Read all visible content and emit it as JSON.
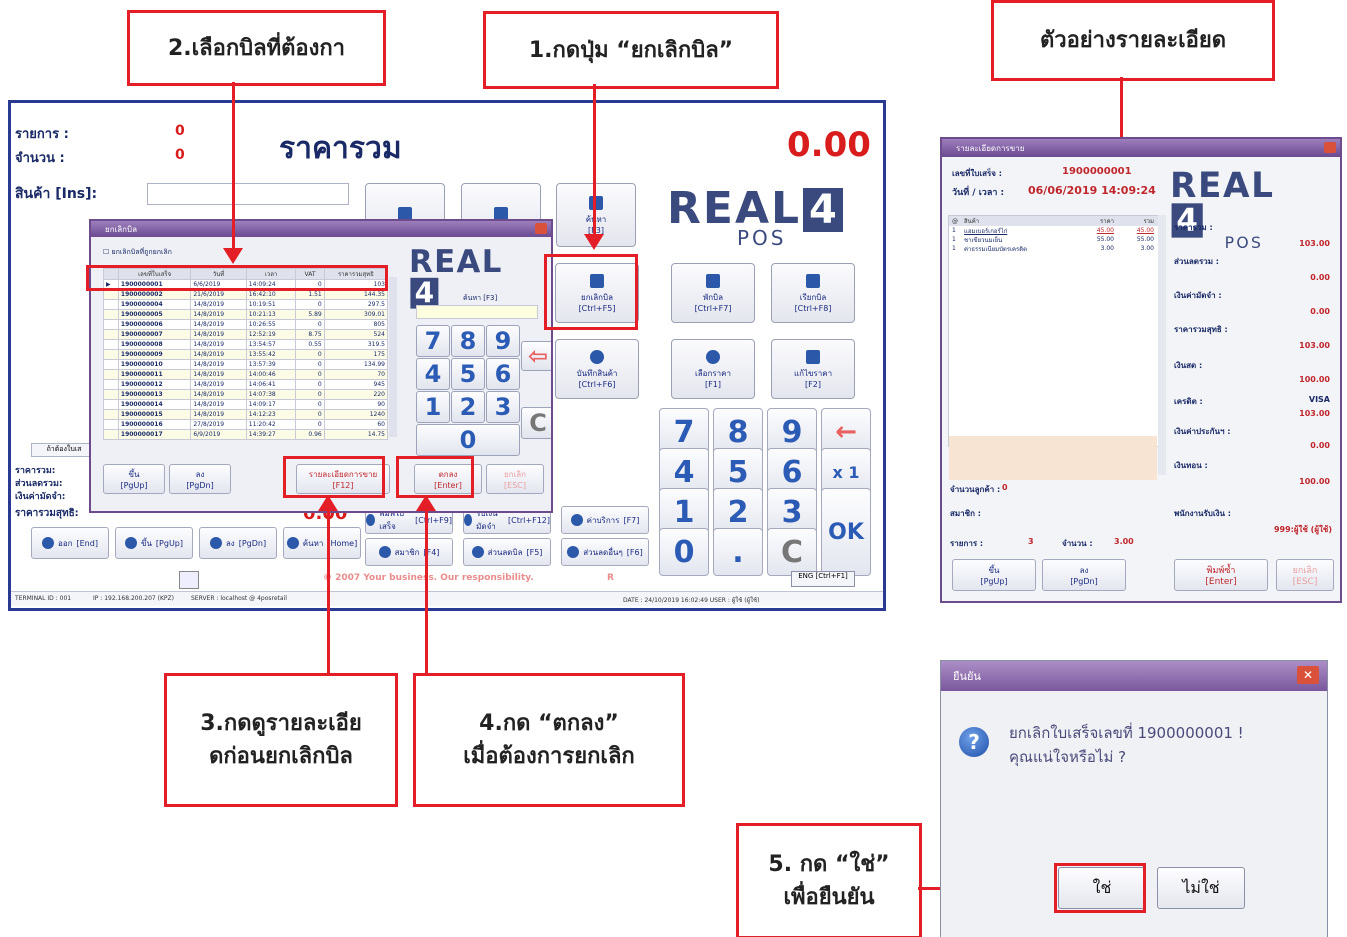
{
  "callouts": {
    "step1": "1.กดปุ่ม “ยกเลิกบิล”",
    "step2": "2.เลือกบิลที่ต้องกา",
    "example": "ตัวอย่างรายละเอียด",
    "step3_line1": "3.กดดูรายละเอีย",
    "step3_line2": "ดก่อนยกเลิกบิล",
    "step4_line1": "4.กด “ตกลง”",
    "step4_line2": "เมื่อต้องการยกเลิก",
    "step5_line1": "5. กด “ใช่”",
    "step5_line2": "เพื่อยืนยัน"
  },
  "pos": {
    "items_label": "รายการ :",
    "items_value": "0",
    "qty_label": "จำนวน :",
    "qty_value": "0",
    "title": "ราคารวม",
    "total": "0.00",
    "product_label": "สินค้า [Ins]:",
    "summary": {
      "total_label": "ราคารวม:",
      "discount_label": "ส่วนลดรวม:",
      "deposit_label": "เงินค่ามัดจำ:",
      "net_label": "ราคารวมสุทธิ:",
      "net_value": "0.00"
    },
    "hold_label": "ถ้าต้องใบเส",
    "func_buttons": [
      {
        "label": "ค้นหา",
        "key": "[F3]"
      },
      {
        "label": "ยกเลิกบิล",
        "key": "[Ctrl+F5]"
      },
      {
        "label": "พักบิล",
        "key": "[Ctrl+F7]"
      },
      {
        "label": "เรียกบิล",
        "key": "[Ctrl+F8]"
      },
      {
        "label": "บันทึกสินค้า",
        "key": "[Ctrl+F6]"
      },
      {
        "label": "เลือกราคา",
        "key": "[F1]"
      },
      {
        "label": "แก้ไขราคา",
        "key": "[F2]"
      }
    ],
    "keypad": [
      "7",
      "8",
      "9",
      "←",
      "4",
      "5",
      "6",
      "x 1",
      "1",
      "2",
      "3",
      "OK",
      "0",
      ".",
      "C"
    ],
    "bottom_buttons": [
      {
        "label": "ออก",
        "key": "[End]"
      },
      {
        "label": "ขึ้น",
        "key": "[PgUp]"
      },
      {
        "label": "ลง",
        "key": "[PgDn]"
      },
      {
        "label": "ค้นหา",
        "key": "[Home]"
      },
      {
        "label": "พิมพ์ใบเสร็จ",
        "key": "[Ctrl+F9]"
      },
      {
        "label": "รับเงินมัดจำ",
        "key": "[Ctrl+F12]"
      },
      {
        "label": "ค่าบริการ",
        "key": "[F7]"
      },
      {
        "label": "สมาชิก",
        "key": "[F4]"
      },
      {
        "label": "ส่วนลดบิล",
        "key": "[F5]"
      },
      {
        "label": "ส่วนลดอื่นๆ",
        "key": "[F6]"
      }
    ],
    "slogan": "© 2007 Your business. Our responsibility.",
    "slogan_r": "R",
    "eng_button": "ENG [Ctrl+F1]",
    "status_terminal": "TERMINAL ID : 001",
    "status_ip": "IP : 192.168.200.207 (KPZ)",
    "status_server": "SERVER : localhost @ 4posretail",
    "status_date": "DATE : 24/10/2019 16:02:49   USER : ผู้ใช้ (ผู้ใช้)"
  },
  "cancel_dialog": {
    "title": "ยกเลิกบิล",
    "checkbox_label": "ยกเลิกบิลที่ถูกยกเลิก",
    "columns": [
      "",
      "เลขที่ใบเสร็จ",
      "วันที่",
      "เวลา",
      "VAT",
      "ราคารวมสุทธิ"
    ],
    "rows": [
      [
        "1900000001",
        "6/6/2019",
        "14:09:24",
        "0",
        "103"
      ],
      [
        "1900000002",
        "21/6/2019",
        "16:42:10",
        "1.51",
        "144.35"
      ],
      [
        "1900000004",
        "14/8/2019",
        "10:19:51",
        "0",
        "297.5"
      ],
      [
        "1900000005",
        "14/8/2019",
        "10:21:13",
        "5.89",
        "309.01"
      ],
      [
        "1900000006",
        "14/8/2019",
        "10:26:55",
        "0",
        "805"
      ],
      [
        "1900000007",
        "14/8/2019",
        "12:52:19",
        "8.75",
        "524"
      ],
      [
        "1900000008",
        "14/8/2019",
        "13:54:57",
        "0.55",
        "319.5"
      ],
      [
        "1900000009",
        "14/8/2019",
        "13:55:42",
        "0",
        "175"
      ],
      [
        "1900000010",
        "14/8/2019",
        "13:57:39",
        "0",
        "134.99"
      ],
      [
        "1900000011",
        "14/8/2019",
        "14:00:46",
        "0",
        "70"
      ],
      [
        "1900000012",
        "14/8/2019",
        "14:06:41",
        "0",
        "945"
      ],
      [
        "1900000013",
        "14/8/2019",
        "14:07:38",
        "0",
        "220"
      ],
      [
        "1900000014",
        "14/8/2019",
        "14:09:17",
        "0",
        "90"
      ],
      [
        "1900000015",
        "14/8/2019",
        "14:12:23",
        "0",
        "1240"
      ],
      [
        "1900000016",
        "27/8/2019",
        "11:20:42",
        "0",
        "60"
      ],
      [
        "1900000017",
        "6/9/2019",
        "14:39:27",
        "0.96",
        "14.75"
      ]
    ],
    "search_label": "ค้นหา [F3]",
    "keypad": [
      "7",
      "8",
      "9",
      "4",
      "5",
      "6",
      "1",
      "2",
      "3",
      "0",
      "C"
    ],
    "up_label": "ขึ้น",
    "up_key": "[PgUp]",
    "down_label": "ลง",
    "down_key": "[PgDn]",
    "detail_label": "รายละเอียดการขาย",
    "detail_key": "[F12]",
    "ok_label": "ตกลง",
    "ok_key": "[Enter]",
    "cancel_label": "ยกเลิก",
    "cancel_key": "[ESC]"
  },
  "detail_window": {
    "title": "รายละเอียดการขาย",
    "receipt_label": "เลขที่ใบเสร็จ :",
    "receipt_value": "1900000001",
    "datetime_label": "วันที่ / เวลา :",
    "datetime_value": "06/06/2019 14:09:24",
    "columns": [
      "@",
      "สินค้า",
      "ราคา",
      "รวม"
    ],
    "items": [
      [
        "1",
        "แฮมเบอร์เกอร์ไก่",
        "45.00",
        "45.00"
      ],
      [
        "1",
        "ชาเขียวนมเย็น",
        "55.00",
        "55.00"
      ],
      [
        "1",
        "ค่าธรรมเนียมบัตรเครดิต",
        "3.00",
        "3.00"
      ]
    ],
    "fields": [
      {
        "label": "ราคารวม :",
        "value": "103.00"
      },
      {
        "label": "ส่วนลดรวม :",
        "value": "0.00"
      },
      {
        "label": "เงินค่ามัดจำ :",
        "value": "0.00"
      },
      {
        "label": "ราคารวมสุทธิ :",
        "value": "103.00"
      },
      {
        "label": "เงินสด :",
        "value": "100.00"
      },
      {
        "label": "เครดิต :",
        "value": "VISA"
      },
      {
        "label": "",
        "value": "103.00"
      },
      {
        "label": "เงินค่าประกันฯ :",
        "value": "0.00"
      },
      {
        "label": "เงินทอน :",
        "value": "100.00"
      }
    ],
    "customers_label": "จำนวนลูกค้า :",
    "customers_value": "0",
    "member_label": "สมาชิก :",
    "cashier_label": "พนักงานรับเงิน :",
    "cashier_value": "999:ผู้ใช้ (ผู้ใช้)",
    "count_label": "รายการ :",
    "count_value": "3",
    "qty_label": "จำนวน :",
    "qty_value": "3.00",
    "up_label": "ขึ้น",
    "up_key": "[PgUp]",
    "down_label": "ลง",
    "down_key": "[PgDn]",
    "print_label": "พิมพ์ซ้ำ",
    "print_key": "[Enter]",
    "cancel_label": "ยกเลิก",
    "cancel_key": "[ESC]"
  },
  "confirm_dialog": {
    "title": "ยืนยัน",
    "message_line1": "ยกเลิกใบเสร็จเลขที่ 1900000001 !",
    "message_line2": "คุณแน่ใจหรือไม่ ?",
    "yes": "ใช่",
    "no": "ไม่ใช่"
  },
  "colors": {
    "accent_red": "#e41e26",
    "pos_border": "#2a3a92",
    "dialog_purple": "#6c4c8c"
  }
}
